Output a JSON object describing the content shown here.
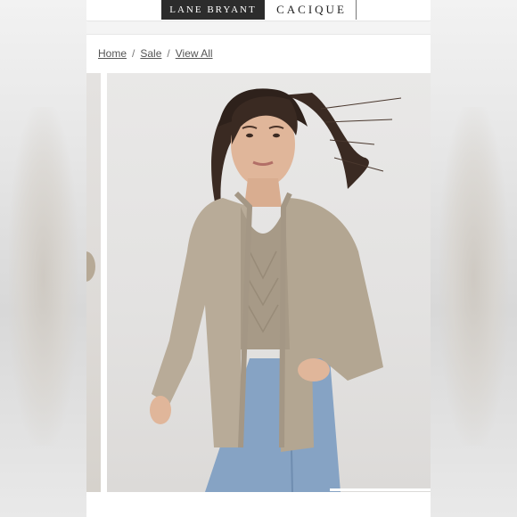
{
  "brands": {
    "active": "LANE BRYANT",
    "inactive": "CACIQUE"
  },
  "breadcrumb": {
    "items": [
      "Home",
      "Sale",
      "View All"
    ],
    "separator": "/"
  },
  "gallery": {
    "hero_image": "model-wearing-oatmeal-cardigan",
    "progress": 0.3
  },
  "colors": {
    "brand_active_bg": "#2c2c2c",
    "sweater": "#b8ab98",
    "denim": "#86a3c4"
  }
}
